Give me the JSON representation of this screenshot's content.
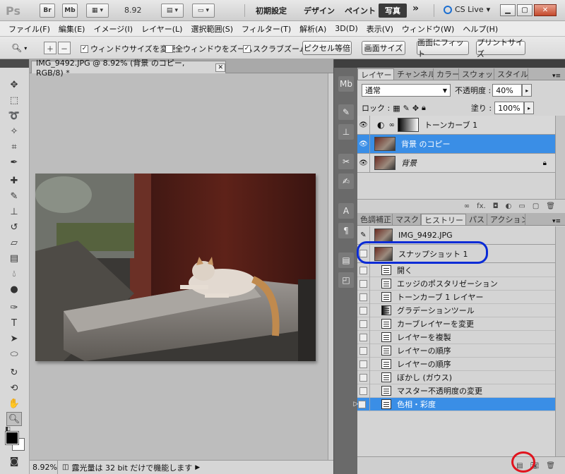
{
  "app": {
    "logo": "Ps",
    "bridge": "Br",
    "minibridge": "Mb",
    "zoom": "8.92",
    "workspaces": [
      "初期設定",
      "デザイン",
      "ペイント"
    ],
    "active_workspace": "写真",
    "more": "»",
    "cs_live": "CS Live"
  },
  "menu": [
    "ファイル(F)",
    "編集(E)",
    "イメージ(I)",
    "レイヤー(L)",
    "選択範囲(S)",
    "フィルター(T)",
    "解析(A)",
    "3D(D)",
    "表示(V)",
    "ウィンドウ(W)",
    "ヘルプ(H)"
  ],
  "options": {
    "resize_windows": "ウィンドウサイズを変更",
    "zoom_all": "全ウィンドウをズーム",
    "scrubby_zoom": "スクラブズーム",
    "actual_pixels": "ピクセル等倍",
    "fit_screen": "画面サイズ",
    "fill_screen": "画面にフィット",
    "print_size": "プリントサイズ"
  },
  "document": {
    "tab_title": "IMG_9492.JPG @ 8.92% (背景 のコピー, RGB/8) *",
    "zoom": "8.92%",
    "status": "露光量は 32 bit だけで機能します"
  },
  "layers_panel": {
    "tabs": [
      "レイヤー",
      "チャンネル",
      "カラー",
      "スウォッチ",
      "スタイル"
    ],
    "blend_mode": "通常",
    "opacity_label": "不透明度 :",
    "opacity": "40%",
    "lock_label": "ロック :",
    "fill_label": "塗り :",
    "fill": "100%",
    "layers": [
      {
        "name": "トーンカーブ 1",
        "selected": false
      },
      {
        "name": "背景 のコピー",
        "selected": true
      },
      {
        "name": "背景",
        "selected": false
      }
    ]
  },
  "history_panel": {
    "tabs": [
      "色調補正",
      "マスク",
      "ヒストリー",
      "パス",
      "アクション"
    ],
    "snapshots": [
      "IMG_9492.JPG",
      "スナップショット 1"
    ],
    "states": [
      "開く",
      "エッジのポスタリゼーション",
      "トーンカーブ 1 レイヤー",
      "グラデーションツール",
      "カーブレイヤーを変更",
      "レイヤーを複製",
      "レイヤーの順序",
      "レイヤーの順序",
      "ぼかし (ガウス)",
      "マスター不透明度の変更",
      "色相・彩度"
    ],
    "selected_state": 10
  }
}
